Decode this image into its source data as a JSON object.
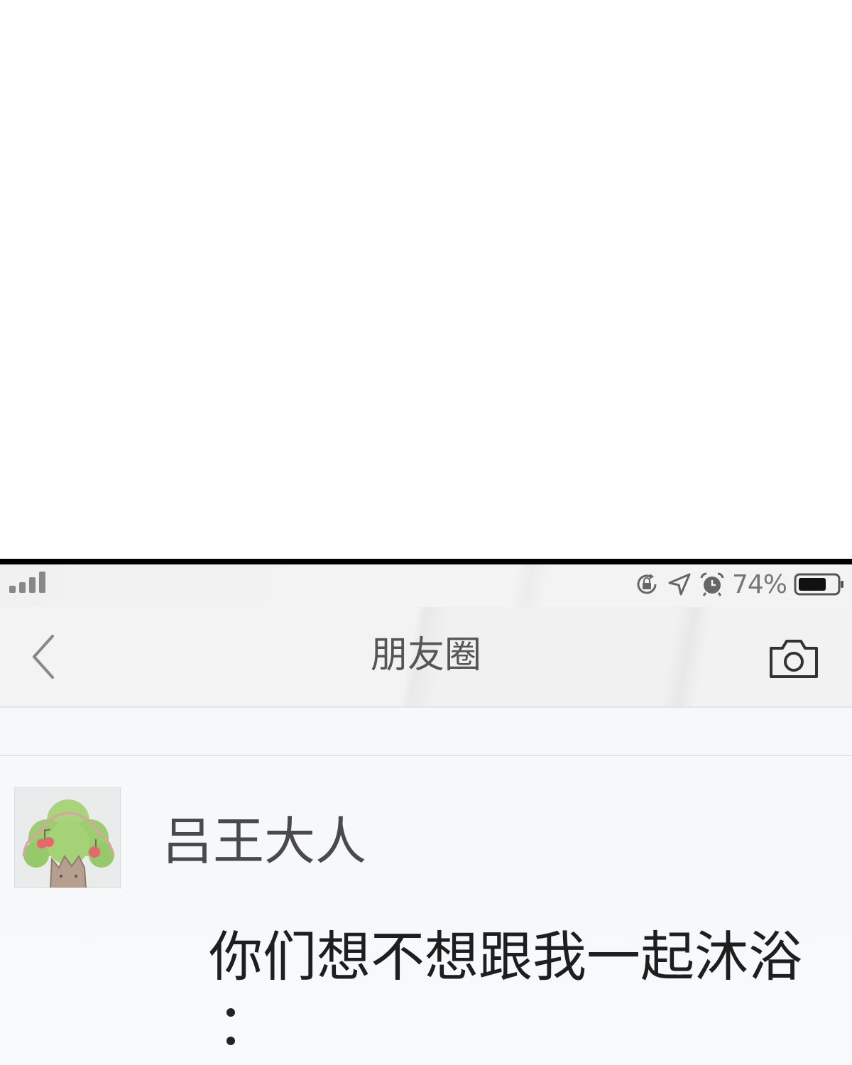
{
  "status_bar": {
    "signal_icon": "signal-bars-icon",
    "icons": [
      "rotation-lock-icon",
      "location-icon",
      "alarm-icon"
    ],
    "battery_percent": "74%",
    "battery_icon": "battery-icon",
    "battery_level": 0.74
  },
  "nav": {
    "back_icon": "chevron-left-icon",
    "title": "朋友圈",
    "camera_icon": "camera-icon"
  },
  "post": {
    "avatar": "tree-avatar",
    "username": "吕王大人",
    "text": "你们想不想跟我一起沐浴",
    "continuation": "dots"
  },
  "colors": {
    "border": "#000000",
    "background": "#f6f8fa",
    "title": "#555555",
    "username": "#4a4a4a",
    "text": "#1e1e1e",
    "icon": "#777777"
  }
}
